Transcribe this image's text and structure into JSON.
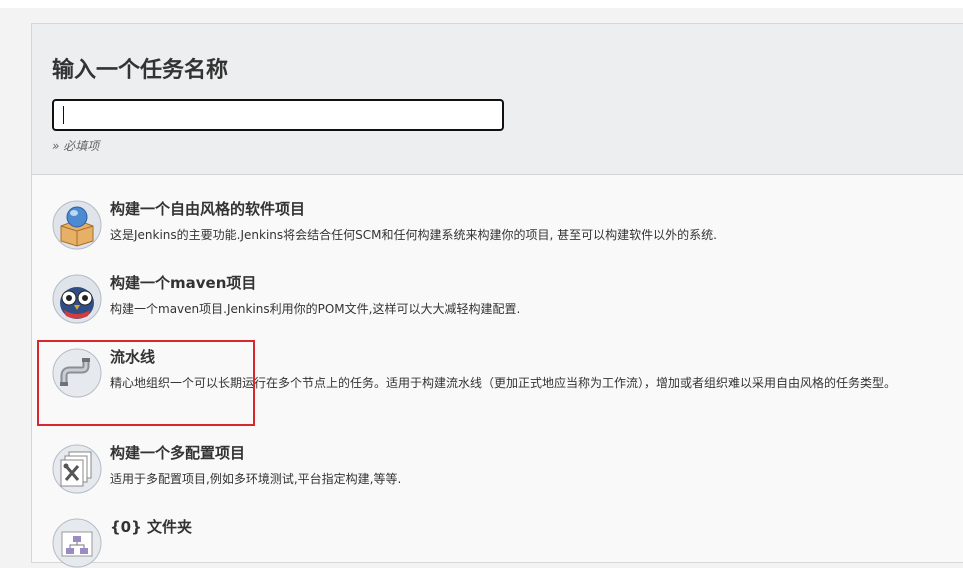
{
  "form": {
    "title": "输入一个任务名称",
    "name_value": "",
    "required_hint": "» 必填项"
  },
  "job_types": [
    {
      "icon": "freestyle-project-icon",
      "title": "构建一个自由风格的软件项目",
      "description": "这是Jenkins的主要功能.Jenkins将会结合任何SCM和任何构建系统来构建你的项目, 甚至可以构建软件以外的系统."
    },
    {
      "icon": "maven-owl-icon",
      "title": "构建一个maven项目",
      "description": "构建一个maven项目.Jenkins利用你的POM文件,这样可以大大减轻构建配置."
    },
    {
      "icon": "pipeline-icon",
      "title": "流水线",
      "description": "精心地组织一个可以长期运行在多个节点上的任务。适用于构建流水线（更加正式地应当称为工作流），增加或者组织难以采用自由风格的任务类型。"
    },
    {
      "icon": "multi-configuration-icon",
      "title": "构建一个多配置项目",
      "description": "适用于多配置项目,例如多环境测试,平台指定构建,等等."
    },
    {
      "icon": "folder-icon",
      "title": "{0} 文件夹",
      "description": ""
    }
  ],
  "colors": {
    "highlight": "#d9272e",
    "header_bg": "#eceeef"
  }
}
